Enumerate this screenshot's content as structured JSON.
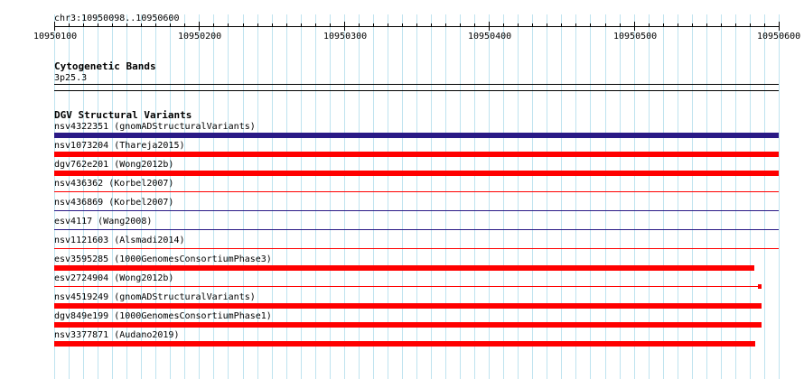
{
  "ruler": {
    "region": "chr3:10950098..10950600",
    "start": 10950100,
    "end": 10950600,
    "major_labels": [
      "10950100",
      "10950200",
      "10950300",
      "10950400",
      "10950500",
      "10950600"
    ],
    "minor_step": 10
  },
  "cytoband_track": {
    "title": "Cytogenetic Bands",
    "band_label": "3p25.3",
    "line_color": "#000000"
  },
  "dgv_track": {
    "title": "DGV Structural Variants",
    "colors": {
      "loss": "#ff0000",
      "gain_loss": "#2a1a86",
      "separator_red": "#ff0000",
      "separator_dark": "#1a1a6a"
    },
    "variants": [
      {
        "label": "nsv4322351 (gnomADStructuralVariants)",
        "color": "gain_loss",
        "start": 10950098,
        "end": 10950600
      },
      {
        "label": "nsv1073204 (Thareja2015)",
        "color": "loss",
        "start": 10950098,
        "end": 10950600
      },
      {
        "label": "dgv762e201 (Wong2012b)",
        "color": "loss",
        "start": 10950098,
        "end": 10950600
      },
      {
        "label": "nsv436362 (Korbel2007)",
        "color": "loss",
        "start": 10950098,
        "end": 10950600
      },
      {
        "label": "nsv436869 (Korbel2007)",
        "color": "gain_loss",
        "start": 10950098,
        "end": 10950600
      },
      {
        "label": "esv4117 (Wang2008)",
        "color": "gain_loss",
        "start": 10950098,
        "end": 10950600
      },
      {
        "label": "nsv1121603 (Alsmadi2014)",
        "color": "loss",
        "start": 10950098,
        "end": 10950600
      },
      {
        "label": "esv3595285 (1000GenomesConsortiumPhase3)",
        "color": "loss",
        "start": 10950098,
        "end": 10950583
      },
      {
        "label": "esv2724904 (Wong2012b)",
        "color": "loss",
        "start": 10950098,
        "end": 10950588
      },
      {
        "label": "nsv4519249 (gnomADStructuralVariants)",
        "color": "loss",
        "start": 10950098,
        "end": 10950588
      },
      {
        "label": "dgv849e199 (1000GenomesConsortiumPhase1)",
        "color": "loss",
        "start": 10950098,
        "end": 10950588
      },
      {
        "label": "nsv3377871 (Audano2019)",
        "color": "loss",
        "start": 10950098,
        "end": 10950584
      }
    ]
  }
}
